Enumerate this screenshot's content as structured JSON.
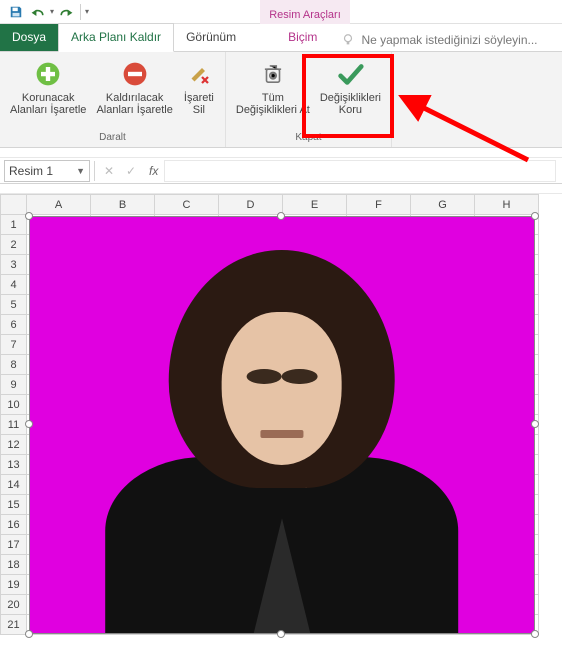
{
  "qat": {
    "save": "Kaydet",
    "undo": "Geri Al",
    "redo": "Yinele"
  },
  "contextual_label": "Resim Araçları",
  "tabs": {
    "file": "Dosya",
    "active": "Arka Planı Kaldır",
    "view": "Görünüm",
    "format": "Biçim"
  },
  "tellme": {
    "placeholder": "Ne yapmak istediğinizi söyleyin..."
  },
  "ribbon": {
    "group1": {
      "mark_keep": "Korunacak\nAlanları İşaretle",
      "mark_remove": "Kaldırılacak\nAlanları İşaretle",
      "delete_mark": "İşareti\nSil",
      "label": "Daralt"
    },
    "group2": {
      "discard": "Tüm\nDeğişiklikleri At",
      "keep": "Değişiklikleri\nKoru",
      "label": "Kapat"
    }
  },
  "namebox": {
    "value": "Resim 1"
  },
  "formula_bar": {
    "fx": "fx",
    "value": ""
  },
  "columns": [
    "A",
    "B",
    "C",
    "D",
    "E",
    "F",
    "G",
    "H"
  ],
  "rows": [
    "1",
    "2",
    "3",
    "4",
    "5",
    "6",
    "7",
    "8",
    "9",
    "10",
    "11",
    "12",
    "13",
    "14",
    "15",
    "16",
    "17",
    "18",
    "19",
    "20",
    "21"
  ],
  "picture": {
    "name": "Resim 1",
    "background_color": "#e000e0"
  }
}
